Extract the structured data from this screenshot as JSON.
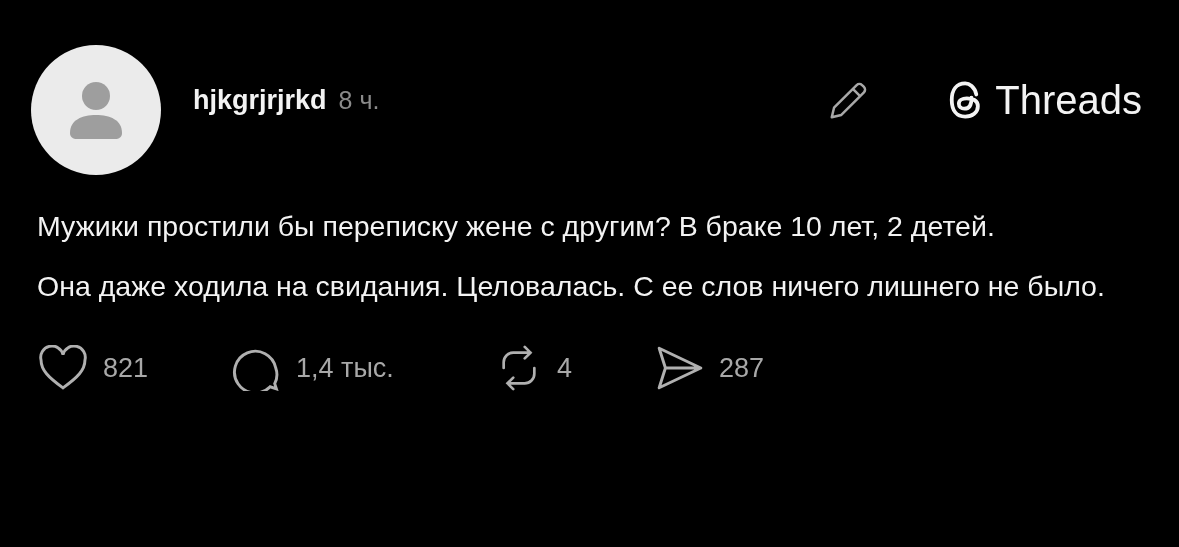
{
  "post": {
    "username": "hjkgrjrjrkd",
    "time": "8 ч.",
    "brand": "Threads",
    "paragraphs": [
      "Мужики простили бы переписку жене с другим? В браке 10 лет, 2 детей.",
      "Она даже ходила на свидания. Целовалась. С ее слов ничего лишнего не было."
    ],
    "actions": [
      {
        "kind": "like",
        "count": "821"
      },
      {
        "kind": "comment",
        "count": "1,4 тыс."
      },
      {
        "kind": "repost",
        "count": "4"
      },
      {
        "kind": "share",
        "count": "287"
      }
    ]
  }
}
